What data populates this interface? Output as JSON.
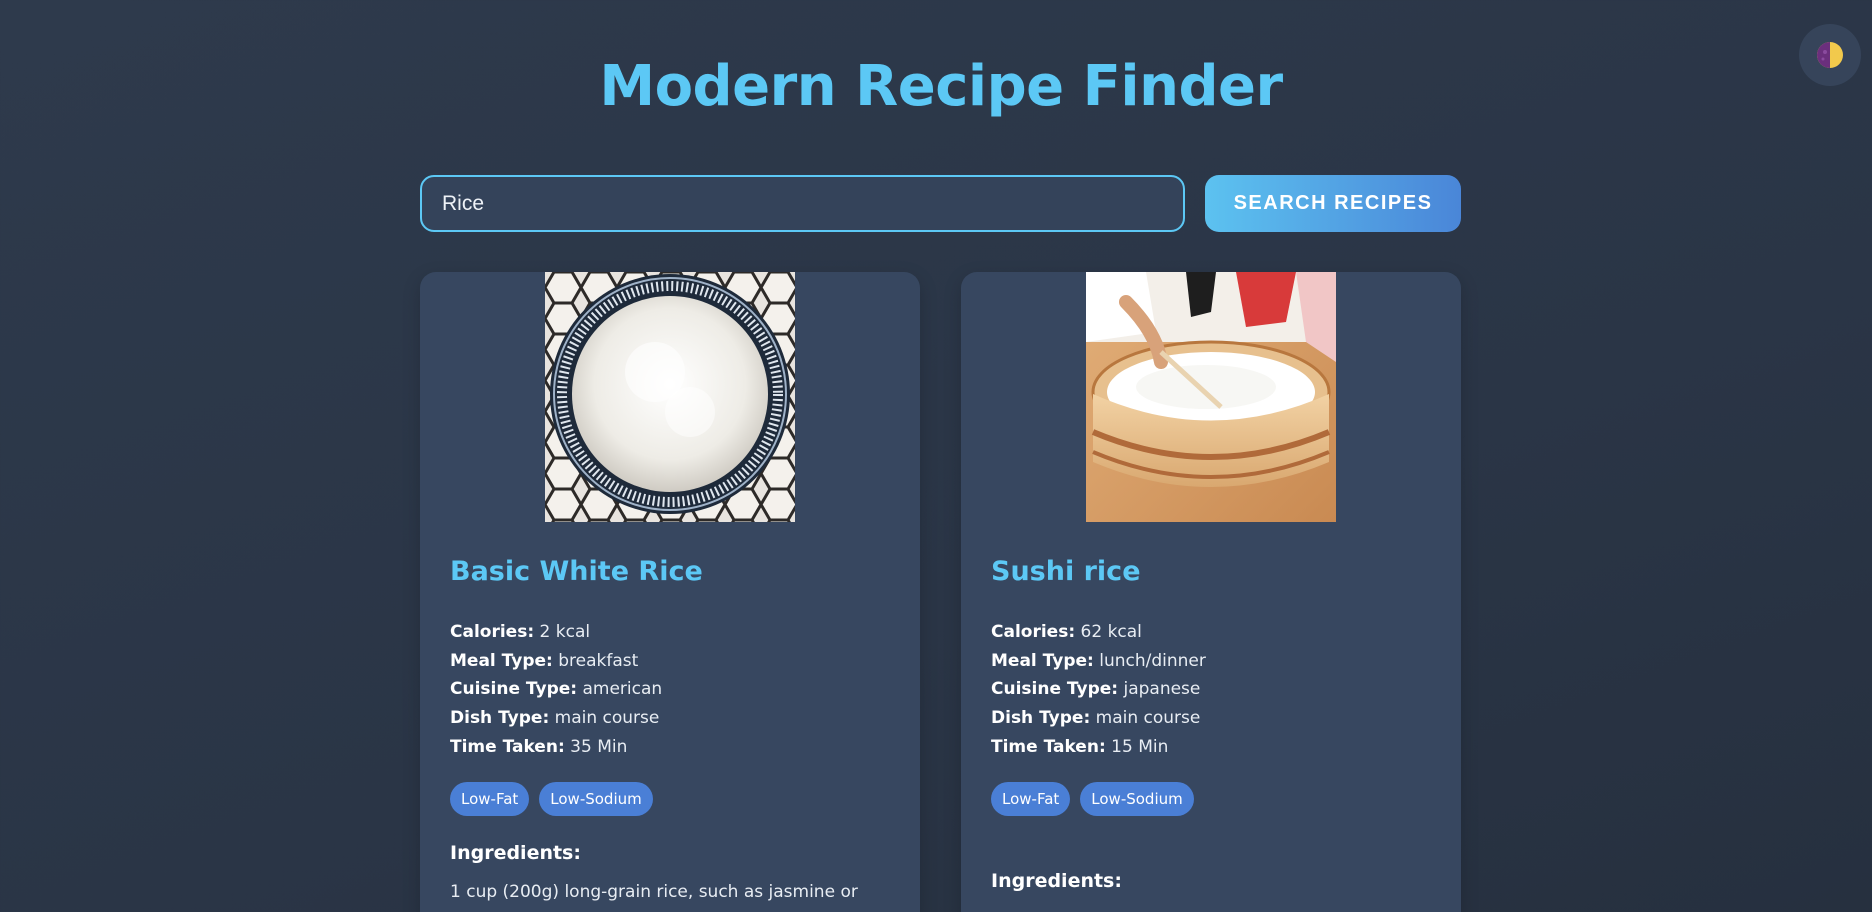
{
  "header": {
    "title": "Modern Recipe Finder",
    "theme_toggle_icon": "half-moon-icon"
  },
  "search": {
    "value": "Rice",
    "button_label": "SEARCH RECIPES"
  },
  "labels": {
    "calories": "Calories:",
    "meal_type": "Meal Type:",
    "cuisine_type": "Cuisine Type:",
    "dish_type": "Dish Type:",
    "time_taken": "Time Taken:",
    "ingredients": "Ingredients:"
  },
  "recipes": [
    {
      "title": "Basic White Rice",
      "image": "bowl-of-white-rice-photo",
      "calories": "2 kcal",
      "meal_type": "breakfast",
      "cuisine_type": "american",
      "dish_type": "main course",
      "time_taken": "35 Min",
      "tags": [
        "Low-Fat",
        "Low-Sodium"
      ],
      "ingredients": [
        "1 cup (200g) long-grain rice, such as jasmine or"
      ]
    },
    {
      "title": "Sushi rice",
      "image": "sushi-rice-wooden-tub-photo",
      "calories": "62 kcal",
      "meal_type": "lunch/dinner",
      "cuisine_type": "japanese",
      "dish_type": "main course",
      "time_taken": "15 Min",
      "tags": [
        "Low-Fat",
        "Low-Sodium"
      ],
      "ingredients": []
    }
  ],
  "colors": {
    "accent": "#5cc8f5",
    "card": "#374760",
    "tag": "#4a7fd6",
    "background": "#2b3647"
  }
}
